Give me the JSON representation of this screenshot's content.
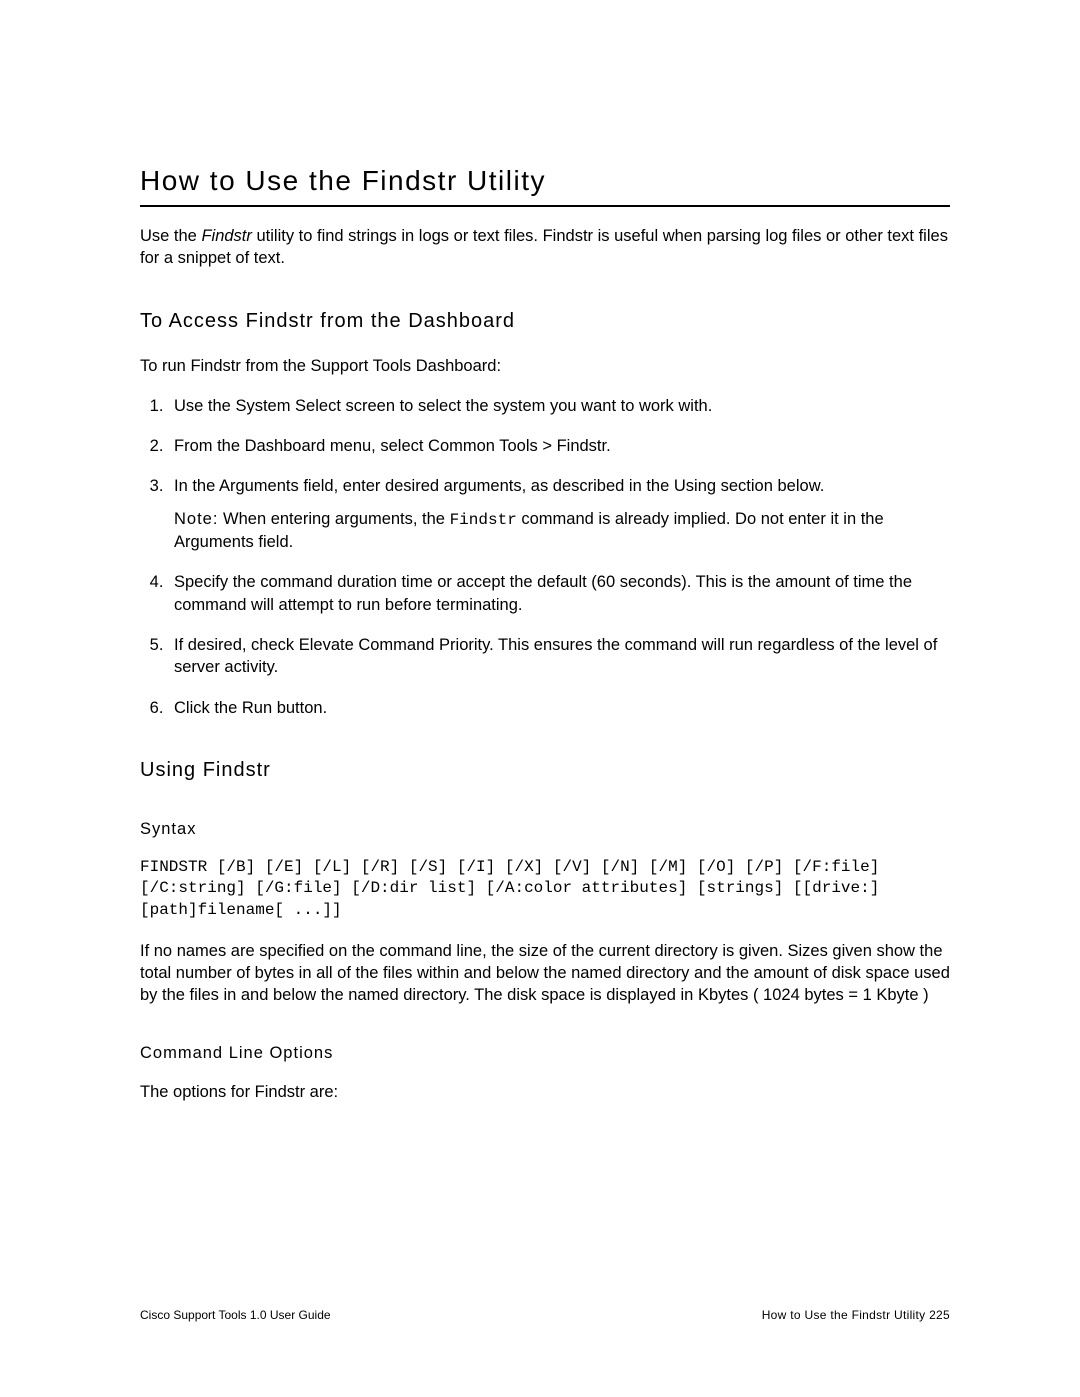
{
  "title": "How to Use the Findstr Utility",
  "intro_prefix": "Use the ",
  "intro_em": "Findstr",
  "intro_suffix": " utility to find strings in logs or text files. Findstr is useful when parsing log files or other text files for a snippet of text.",
  "section1_heading": "To Access Findstr from the Dashboard",
  "section1_intro": "To run Findstr from the Support Tools Dashboard:",
  "steps": {
    "s1": "Use the System Select screen to select the system you want to work with.",
    "s2": "From the Dashboard menu, select Common Tools > Findstr.",
    "s3": "In the Arguments field, enter desired arguments, as described in the Using section below.",
    "s3_note_label": "Note:",
    "s3_note_before": " When entering arguments, the ",
    "s3_note_code": "Findstr",
    "s3_note_after": " command is already implied. Do not enter it in the Arguments field.",
    "s4": "Specify the command duration time or accept the default (60 seconds). This is the amount of time the command will attempt to run before terminating.",
    "s5": "If desired, check Elevate Command Priority. This ensures the command will run regardless of the level of server activity.",
    "s6": "Click the Run button."
  },
  "section2_heading": "Using Findstr",
  "syntax_heading": "Syntax",
  "syntax_block": "FINDSTR [/B] [/E] [/L] [/R] [/S] [/I] [/X] [/V] [/N] [/M] [/O] [/P] [/F:file] [/C:string] [/G:file] [/D:dir list] [/A:color attributes] [strings] [[drive:][path]filename[ ...]]",
  "syntax_para": "If no names are specified on the command line, the size of the current directory is given. Sizes given show the total number of bytes in all of the files within and below the named directory and the amount of disk space used by the files in and below the named directory. The disk space is displayed in Kbytes ( 1024 bytes = 1 Kbyte )",
  "cli_heading": "Command Line Options",
  "cli_intro": "The options for Findstr are:",
  "footer_left": "Cisco Support Tools 1.0 User Guide",
  "footer_right": "How to Use the Findstr Utility   225"
}
